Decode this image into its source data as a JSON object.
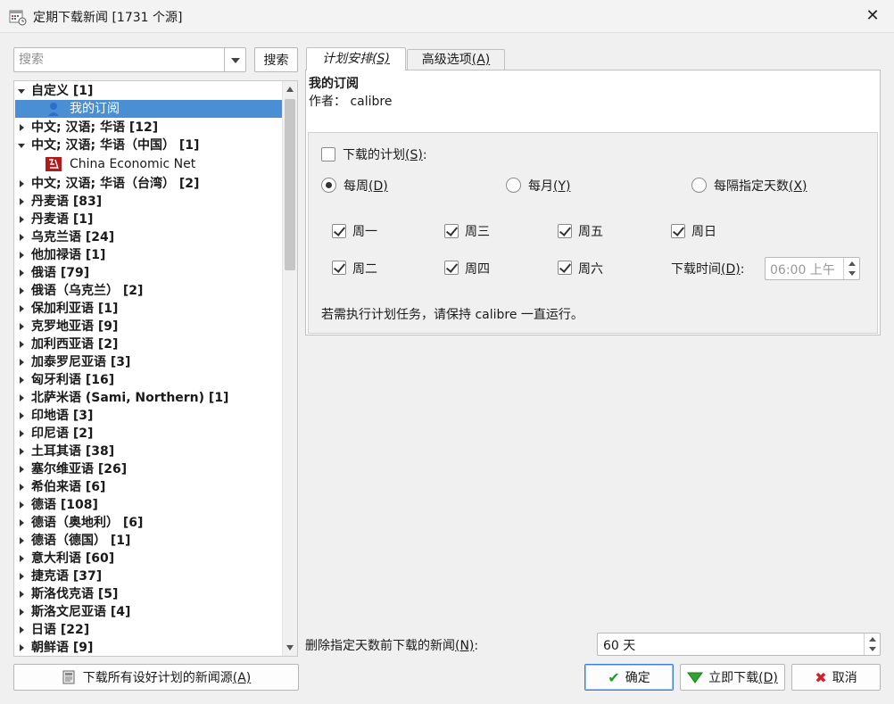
{
  "window": {
    "title": "定期下载新闻 [1731 个源]"
  },
  "search": {
    "placeholder": "搜索",
    "button": "搜索"
  },
  "tree": {
    "items": [
      {
        "label": "自定义 [1]",
        "expanded": true
      },
      {
        "label": "我的订阅",
        "child": true,
        "selected": true,
        "icon": "user-icon"
      },
      {
        "label": "中文; 汉语; 华语 [12]"
      },
      {
        "label": "中文; 汉语; 华语（中国） [1]",
        "expanded": true
      },
      {
        "label": "China Economic Net",
        "child": true,
        "icon": "news-logo-icon"
      },
      {
        "label": "中文; 汉语; 华语（台湾） [2]"
      },
      {
        "label": "丹麦语 [83]"
      },
      {
        "label": "丹麦语 [1]"
      },
      {
        "label": "乌克兰语 [24]"
      },
      {
        "label": "他加禄语 [1]"
      },
      {
        "label": "俄语 [79]"
      },
      {
        "label": "俄语（乌克兰） [2]"
      },
      {
        "label": "保加利亚语 [1]"
      },
      {
        "label": "克罗地亚语 [9]"
      },
      {
        "label": "加利西亚语 [2]"
      },
      {
        "label": "加泰罗尼亚语 [3]"
      },
      {
        "label": "匈牙利语 [16]"
      },
      {
        "label": "北萨米语 (Sami, Northern) [1]"
      },
      {
        "label": "印地语 [3]"
      },
      {
        "label": "印尼语 [2]"
      },
      {
        "label": "土耳其语 [38]"
      },
      {
        "label": "塞尔维亚语 [26]"
      },
      {
        "label": "希伯来语 [6]"
      },
      {
        "label": "德语 [108]"
      },
      {
        "label": "德语（奥地利） [6]"
      },
      {
        "label": "德语（德国） [1]"
      },
      {
        "label": "意大利语 [60]"
      },
      {
        "label": "捷克语 [37]"
      },
      {
        "label": "斯洛伐克语 [5]"
      },
      {
        "label": "斯洛文尼亚语 [4]"
      },
      {
        "label": "日语 [22]"
      },
      {
        "label": "朝鲜语 [9]"
      }
    ]
  },
  "tabs": {
    "schedule": {
      "label": "计划安排",
      "key": "(S)"
    },
    "advanced": {
      "label": "高级选项",
      "key": "(A)"
    }
  },
  "recipe": {
    "title": "我的订阅",
    "author_label": "作者：",
    "author": "calibre"
  },
  "schedule": {
    "enable": {
      "label": "下载的计划",
      "key": "(S)",
      "suffix": ":",
      "checked": false
    },
    "weekly": {
      "label": "每周",
      "key": "(D)",
      "selected": true
    },
    "monthly": {
      "label": "每月",
      "key": "(Y)",
      "selected": false
    },
    "interval": {
      "label": "每隔指定天数",
      "key": "(X)",
      "selected": false
    },
    "days": {
      "mon": {
        "label": "周一",
        "checked": true
      },
      "wed": {
        "label": "周三",
        "checked": true
      },
      "fri": {
        "label": "周五",
        "checked": true
      },
      "sun": {
        "label": "周日",
        "checked": true
      },
      "tue": {
        "label": "周二",
        "checked": true
      },
      "thu": {
        "label": "周四",
        "checked": true
      },
      "sat": {
        "label": "周六",
        "checked": true
      }
    },
    "time_label": "下载时间",
    "time_key": "(D)",
    "time_suffix": ":",
    "time_value": "06:00 上午",
    "note": "若需执行计划任务，请保持 calibre 一直运行。"
  },
  "delete": {
    "label": "删除指定天数前下载的新闻",
    "key": "(N)",
    "suffix": ":",
    "value": "60 天"
  },
  "buttons": {
    "bulk": "下载所有设好计划的新闻源",
    "bulk_key": "(A)",
    "ok": "确定",
    "download_now": "立即下载",
    "download_key": "(D)",
    "cancel": "取消"
  }
}
